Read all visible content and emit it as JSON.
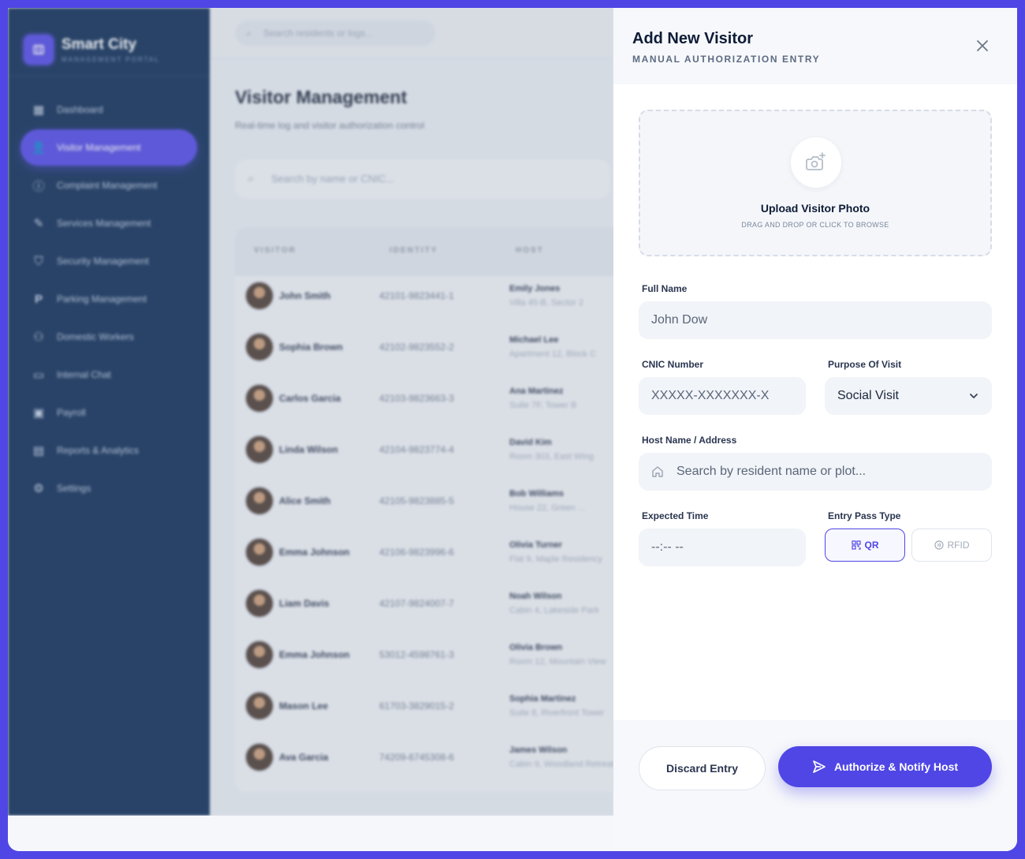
{
  "colors": {
    "accent": "#4f46e5",
    "sidebar": "#0b2a55",
    "panel_bg": "#ffffff"
  },
  "brand": {
    "title": "Smart City",
    "subtitle": "MANAGEMENT PORTAL",
    "icon": "shield-logo-icon"
  },
  "topbar": {
    "search_placeholder": "Search residents or logs..."
  },
  "sidebar": {
    "items": [
      {
        "label": "Dashboard",
        "icon": "dashboard-icon",
        "active": false
      },
      {
        "label": "Visitor Management",
        "icon": "visitor-icon",
        "active": true
      },
      {
        "label": "Complaint Management",
        "icon": "alert-icon",
        "active": false
      },
      {
        "label": "Services Management",
        "icon": "wrench-icon",
        "active": false
      },
      {
        "label": "Security Management",
        "icon": "shield-icon",
        "active": false
      },
      {
        "label": "Parking Management",
        "icon": "parking-icon",
        "active": false
      },
      {
        "label": "Domestic Workers",
        "icon": "workers-icon",
        "active": false
      },
      {
        "label": "Internal Chat",
        "icon": "chat-icon",
        "active": false
      },
      {
        "label": "Payroll",
        "icon": "payroll-icon",
        "active": false
      },
      {
        "label": "Reports & Analytics",
        "icon": "reports-icon",
        "active": false
      },
      {
        "label": "Settings",
        "icon": "gear-icon",
        "active": false
      }
    ]
  },
  "main": {
    "title": "Visitor Management",
    "subtitle": "Real-time log and visitor authorization control",
    "search_placeholder": "Search by name or CNIC...",
    "table": {
      "headers": [
        "VISITOR",
        "IDENTITY",
        "HOST"
      ],
      "rows": [
        {
          "name": "John Smith",
          "cnic": "42101-9823441-1",
          "host": "Emily Jones",
          "address": "Villa 45-B, Sector 2"
        },
        {
          "name": "Sophia Brown",
          "cnic": "42102-9823552-2",
          "host": "Michael Lee",
          "address": "Apartment 12, Block C"
        },
        {
          "name": "Carlos Garcia",
          "cnic": "42103-9823663-3",
          "host": "Ana Martinez",
          "address": "Suite 7F, Tower B"
        },
        {
          "name": "Linda Wilson",
          "cnic": "42104-9823774-4",
          "host": "David Kim",
          "address": "Room 303, East Wing"
        },
        {
          "name": "Alice Smith",
          "cnic": "42105-9823885-5",
          "host": "Bob Williams",
          "address": "House 22, Green ..."
        },
        {
          "name": "Emma Johnson",
          "cnic": "42106-9823996-6",
          "host": "Olivia Turner",
          "address": "Flat 9, Maple Residency"
        },
        {
          "name": "Liam Davis",
          "cnic": "42107-9824007-7",
          "host": "Noah Wilson",
          "address": "Cabin 4, Lakeside Park"
        },
        {
          "name": "Emma Johnson",
          "cnic": "53012-4598761-3",
          "host": "Olivia Brown",
          "address": "Room 12, Mountain View"
        },
        {
          "name": "Mason Lee",
          "cnic": "61703-3829015-2",
          "host": "Sophia Martinez",
          "address": "Suite 8, Riverfront Tower"
        },
        {
          "name": "Ava Garcia",
          "cnic": "74209-6745308-6",
          "host": "James Wilson",
          "address": "Cabin 9, Woodland Retreat"
        }
      ]
    }
  },
  "panel": {
    "title": "Add New Visitor",
    "subtitle": "MANUAL AUTHORIZATION ENTRY",
    "upload": {
      "title": "Upload Visitor Photo",
      "hint": "DRAG AND DROP OR CLICK TO BROWSE"
    },
    "full_name": {
      "label": "Full Name",
      "placeholder": "John Dow"
    },
    "cnic": {
      "label": "CNIC Number",
      "placeholder": "XXXXX-XXXXXXX-X"
    },
    "purpose": {
      "label": "Purpose Of Visit",
      "value": "Social Visit"
    },
    "host": {
      "label": "Host Name / Address",
      "placeholder": "Search by resident name or plot..."
    },
    "expected_time": {
      "label": "Expected Time",
      "value": "--:-- --"
    },
    "pass_type": {
      "label": "Entry Pass Type",
      "options": [
        "QR",
        "RFID"
      ],
      "selected": "QR"
    },
    "discard_label": "Discard Entry",
    "authorize_label": "Authorize & Notify Host"
  }
}
